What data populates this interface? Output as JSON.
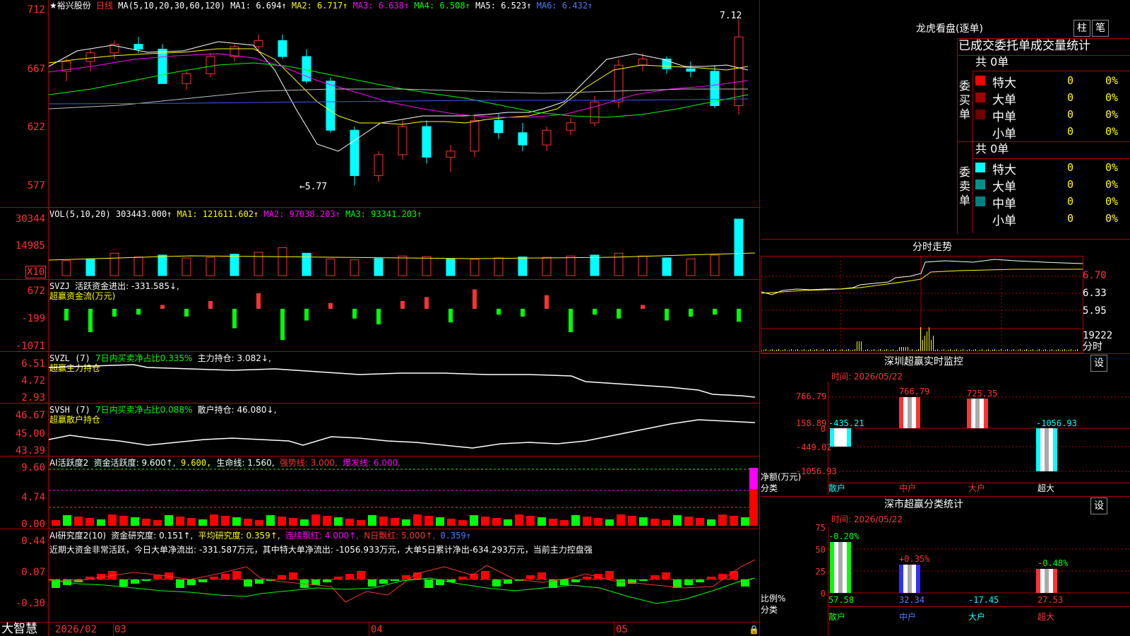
{
  "stock": {
    "name": "★裕兴股份",
    "period": "日线",
    "ma_header": "MA(5,10,20,30,60,120)",
    "ma1": "MA1: 6.694↑",
    "ma2": "MA2: 6.717↑",
    "ma3": "MA3: 6.638↑",
    "ma4": "MA4: 6.508↑",
    "ma5": "MA5: 6.523↑",
    "ma6": "MA6: 6.432↑",
    "y_ticks": [
      "712",
      "667",
      "622",
      "577"
    ],
    "high_label": "7.12",
    "low_label": "5.77"
  },
  "vol": {
    "header": "VOL(5,10,20)",
    "value": "303443.000↑",
    "ma1": "MA1: 121611.602↑",
    "ma2": "MA2: 97038.203↑",
    "ma3": "MA3: 93341.203↑",
    "y_ticks": [
      "30344",
      "14985"
    ],
    "unit": "X10"
  },
  "svzj": {
    "header": "SVZJ",
    "desc": "活跃资金进出: -331.585↓,",
    "subtitle": "超赢资金流(万元)",
    "y_ticks": [
      "672",
      "-199",
      "-1071"
    ]
  },
  "svzl": {
    "header": "SVZL (7)",
    "desc": "7日内买卖净占比0.335%",
    "desc2": "主力持仓: 3.082↓,",
    "subtitle": "超赢主力持仓",
    "y_ticks": [
      "6.51",
      "4.72",
      "2.93"
    ]
  },
  "svsh": {
    "header": "SVSH (7)",
    "desc": "7日内买卖净占比0.088%",
    "desc2": "散户持仓: 46.080↓,",
    "subtitle": "超赢散户持仓",
    "y_ticks": [
      "46.67",
      "45.00",
      "43.39"
    ]
  },
  "ai1": {
    "header": "AI活跃度2",
    "a": "资金活跃度: 9.600↑,",
    "b": "9.600,",
    "c": "生命线: 1.560,",
    "d": "强势线: 3.000,",
    "e": "爆发线: 6.000,",
    "y_ticks": [
      "9.60",
      "4.74",
      "0.00"
    ]
  },
  "ai2": {
    "header": "AI研究度2(10)",
    "a": "资金研究度: 0.151↑,",
    "b": "平均研究度: 0.359↑,",
    "c": "连续飘红: 4.000↑,",
    "d": "N日飘红: 5.000↑,",
    "e": "0.359↑",
    "note": "近期大资金非常活跃，今日大单净流出: -331.587万元，其中特大单净流出: -1056.933万元，大单5日累计净出-634.293万元，当前主力控盘强",
    "y_ticks": [
      "0.44",
      "0.07",
      "-0.30"
    ]
  },
  "xaxis": {
    "brand": "大智慧",
    "labels": [
      "2026/02",
      "03",
      "04",
      "05"
    ]
  },
  "right": {
    "longhu_title": "龙虎看盘(逐单)",
    "btn_zhu": "柱",
    "btn_bi": "笔",
    "stats_title": "已成交委托单成交量统计",
    "buy_label": "委买单",
    "sell_label": "委卖单",
    "buy_total": "共 0单",
    "sell_total": "共 0单",
    "buy_rows": [
      {
        "name": "特大",
        "count": "0",
        "pct": "0%",
        "color": "#ff0000"
      },
      {
        "name": "大单",
        "count": "0",
        "pct": "0%",
        "color": "#a00000"
      },
      {
        "name": "中单",
        "count": "0",
        "pct": "0%",
        "color": "#700000"
      },
      {
        "name": "小单",
        "count": "0",
        "pct": "0%",
        "color": "#000000"
      }
    ],
    "sell_rows": [
      {
        "name": "特大",
        "count": "0",
        "pct": "0%",
        "color": "#00ffff"
      },
      {
        "name": "大单",
        "count": "0",
        "pct": "0%",
        "color": "#009090"
      },
      {
        "name": "中单",
        "count": "0",
        "pct": "0%",
        "color": "#008080"
      },
      {
        "name": "小单",
        "count": "0",
        "pct": "0%",
        "color": "#000000"
      }
    ],
    "intraday_title": "分时走势",
    "intraday_ticks": [
      "6.70",
      "6.33",
      "5.95"
    ],
    "intraday_vol_tick": "19222",
    "intraday_foot": "分时",
    "sz_monitor_title": "深圳超赢实时监控",
    "sz_btn": "设",
    "sz_time": "时间: 2026/05/22",
    "sz_ticks": [
      "766.79",
      "158.89",
      "0",
      "-449.02",
      "-1056.93"
    ],
    "sz_labels": [
      "-435.21",
      "766.79",
      "725.35",
      "-1056.93"
    ],
    "sz_cats": [
      "散户",
      "中户",
      "大户",
      "超大"
    ],
    "sz_side": "净额(万元)",
    "sz_side2": "分类",
    "szs_title": "深市超赢分类统计",
    "szs_btn": "设",
    "szs_time": "时间: 2026/05/22",
    "szs_ticks": [
      "75",
      "50",
      "25",
      "0"
    ],
    "szs_top": [
      "-0.20%",
      "+0.35%",
      "-0.48%"
    ],
    "szs_bottom": [
      "57.58",
      "32.34",
      "-17.45",
      "27.53"
    ],
    "szs_cats": [
      "散户",
      "中户",
      "大户",
      "超大"
    ],
    "szs_side": "比例%",
    "szs_side2": "分类"
  },
  "chart_data": [
    {
      "type": "candlestick",
      "title": "裕兴股份 日线",
      "ylim": [
        5.6,
        7.2
      ],
      "series_sample": [
        {
          "o": 6.7,
          "h": 6.8,
          "l": 6.62,
          "c": 6.78
        },
        {
          "o": 6.78,
          "h": 6.88,
          "l": 6.7,
          "c": 6.85
        },
        {
          "o": 6.85,
          "h": 6.95,
          "l": 6.8,
          "c": 6.92
        },
        {
          "o": 6.92,
          "h": 6.98,
          "l": 6.85,
          "c": 6.88
        },
        {
          "o": 6.88,
          "h": 6.92,
          "l": 6.7,
          "c": 6.6
        },
        {
          "o": 6.6,
          "h": 6.7,
          "l": 6.55,
          "c": 6.68
        },
        {
          "o": 6.68,
          "h": 6.85,
          "l": 6.65,
          "c": 6.82
        },
        {
          "o": 6.82,
          "h": 6.92,
          "l": 6.78,
          "c": 6.9
        },
        {
          "o": 6.9,
          "h": 7.0,
          "l": 6.85,
          "c": 6.95
        },
        {
          "o": 6.95,
          "h": 7.0,
          "l": 6.8,
          "c": 6.82
        },
        {
          "o": 6.82,
          "h": 6.88,
          "l": 6.6,
          "c": 6.62
        },
        {
          "o": 6.62,
          "h": 6.65,
          "l": 6.2,
          "c": 6.22
        },
        {
          "o": 6.22,
          "h": 6.25,
          "l": 5.77,
          "c": 5.85
        },
        {
          "o": 5.85,
          "h": 6.05,
          "l": 5.8,
          "c": 6.02
        },
        {
          "o": 6.02,
          "h": 6.3,
          "l": 5.98,
          "c": 6.25
        },
        {
          "o": 6.25,
          "h": 6.3,
          "l": 5.95,
          "c": 6.0
        },
        {
          "o": 6.0,
          "h": 6.1,
          "l": 5.88,
          "c": 6.05
        },
        {
          "o": 6.05,
          "h": 6.35,
          "l": 6.0,
          "c": 6.3
        },
        {
          "o": 6.3,
          "h": 6.35,
          "l": 6.15,
          "c": 6.2
        },
        {
          "o": 6.2,
          "h": 6.28,
          "l": 6.05,
          "c": 6.1
        },
        {
          "o": 6.1,
          "h": 6.25,
          "l": 6.05,
          "c": 6.22
        },
        {
          "o": 6.22,
          "h": 6.32,
          "l": 6.18,
          "c": 6.28
        },
        {
          "o": 6.28,
          "h": 6.5,
          "l": 6.25,
          "c": 6.45
        },
        {
          "o": 6.45,
          "h": 6.8,
          "l": 6.4,
          "c": 6.75
        },
        {
          "o": 6.75,
          "h": 6.85,
          "l": 6.7,
          "c": 6.8
        },
        {
          "o": 6.8,
          "h": 6.82,
          "l": 6.68,
          "c": 6.72
        },
        {
          "o": 6.72,
          "h": 6.78,
          "l": 6.65,
          "c": 6.7
        },
        {
          "o": 6.7,
          "h": 6.75,
          "l": 6.4,
          "c": 6.42
        },
        {
          "o": 6.42,
          "h": 7.12,
          "l": 6.35,
          "c": 6.98
        }
      ]
    },
    {
      "type": "bar",
      "title": "VOL",
      "ylim": [
        0,
        30344
      ],
      "values_sample": [
        8000,
        9000,
        12000,
        10000,
        11000,
        9500,
        9800,
        11500,
        12500,
        14985,
        12000,
        9000,
        8500,
        9200,
        10500,
        10200,
        9000,
        8800,
        9500,
        10000,
        9800,
        10500,
        11000,
        12000,
        10500,
        9500,
        9000,
        11000,
        30344
      ]
    },
    {
      "type": "bar",
      "title": "超赢资金流(万元)",
      "ylim": [
        -1071,
        672
      ],
      "values_sample": [
        -300,
        -600,
        -200,
        -150,
        100,
        -199,
        200,
        -500,
        400,
        -800,
        -300,
        150,
        -250,
        -400,
        200,
        300,
        -350,
        500,
        -150,
        -200,
        350,
        -600,
        -150,
        -250,
        100,
        -300,
        -200,
        -150,
        -331.585
      ]
    }
  ]
}
